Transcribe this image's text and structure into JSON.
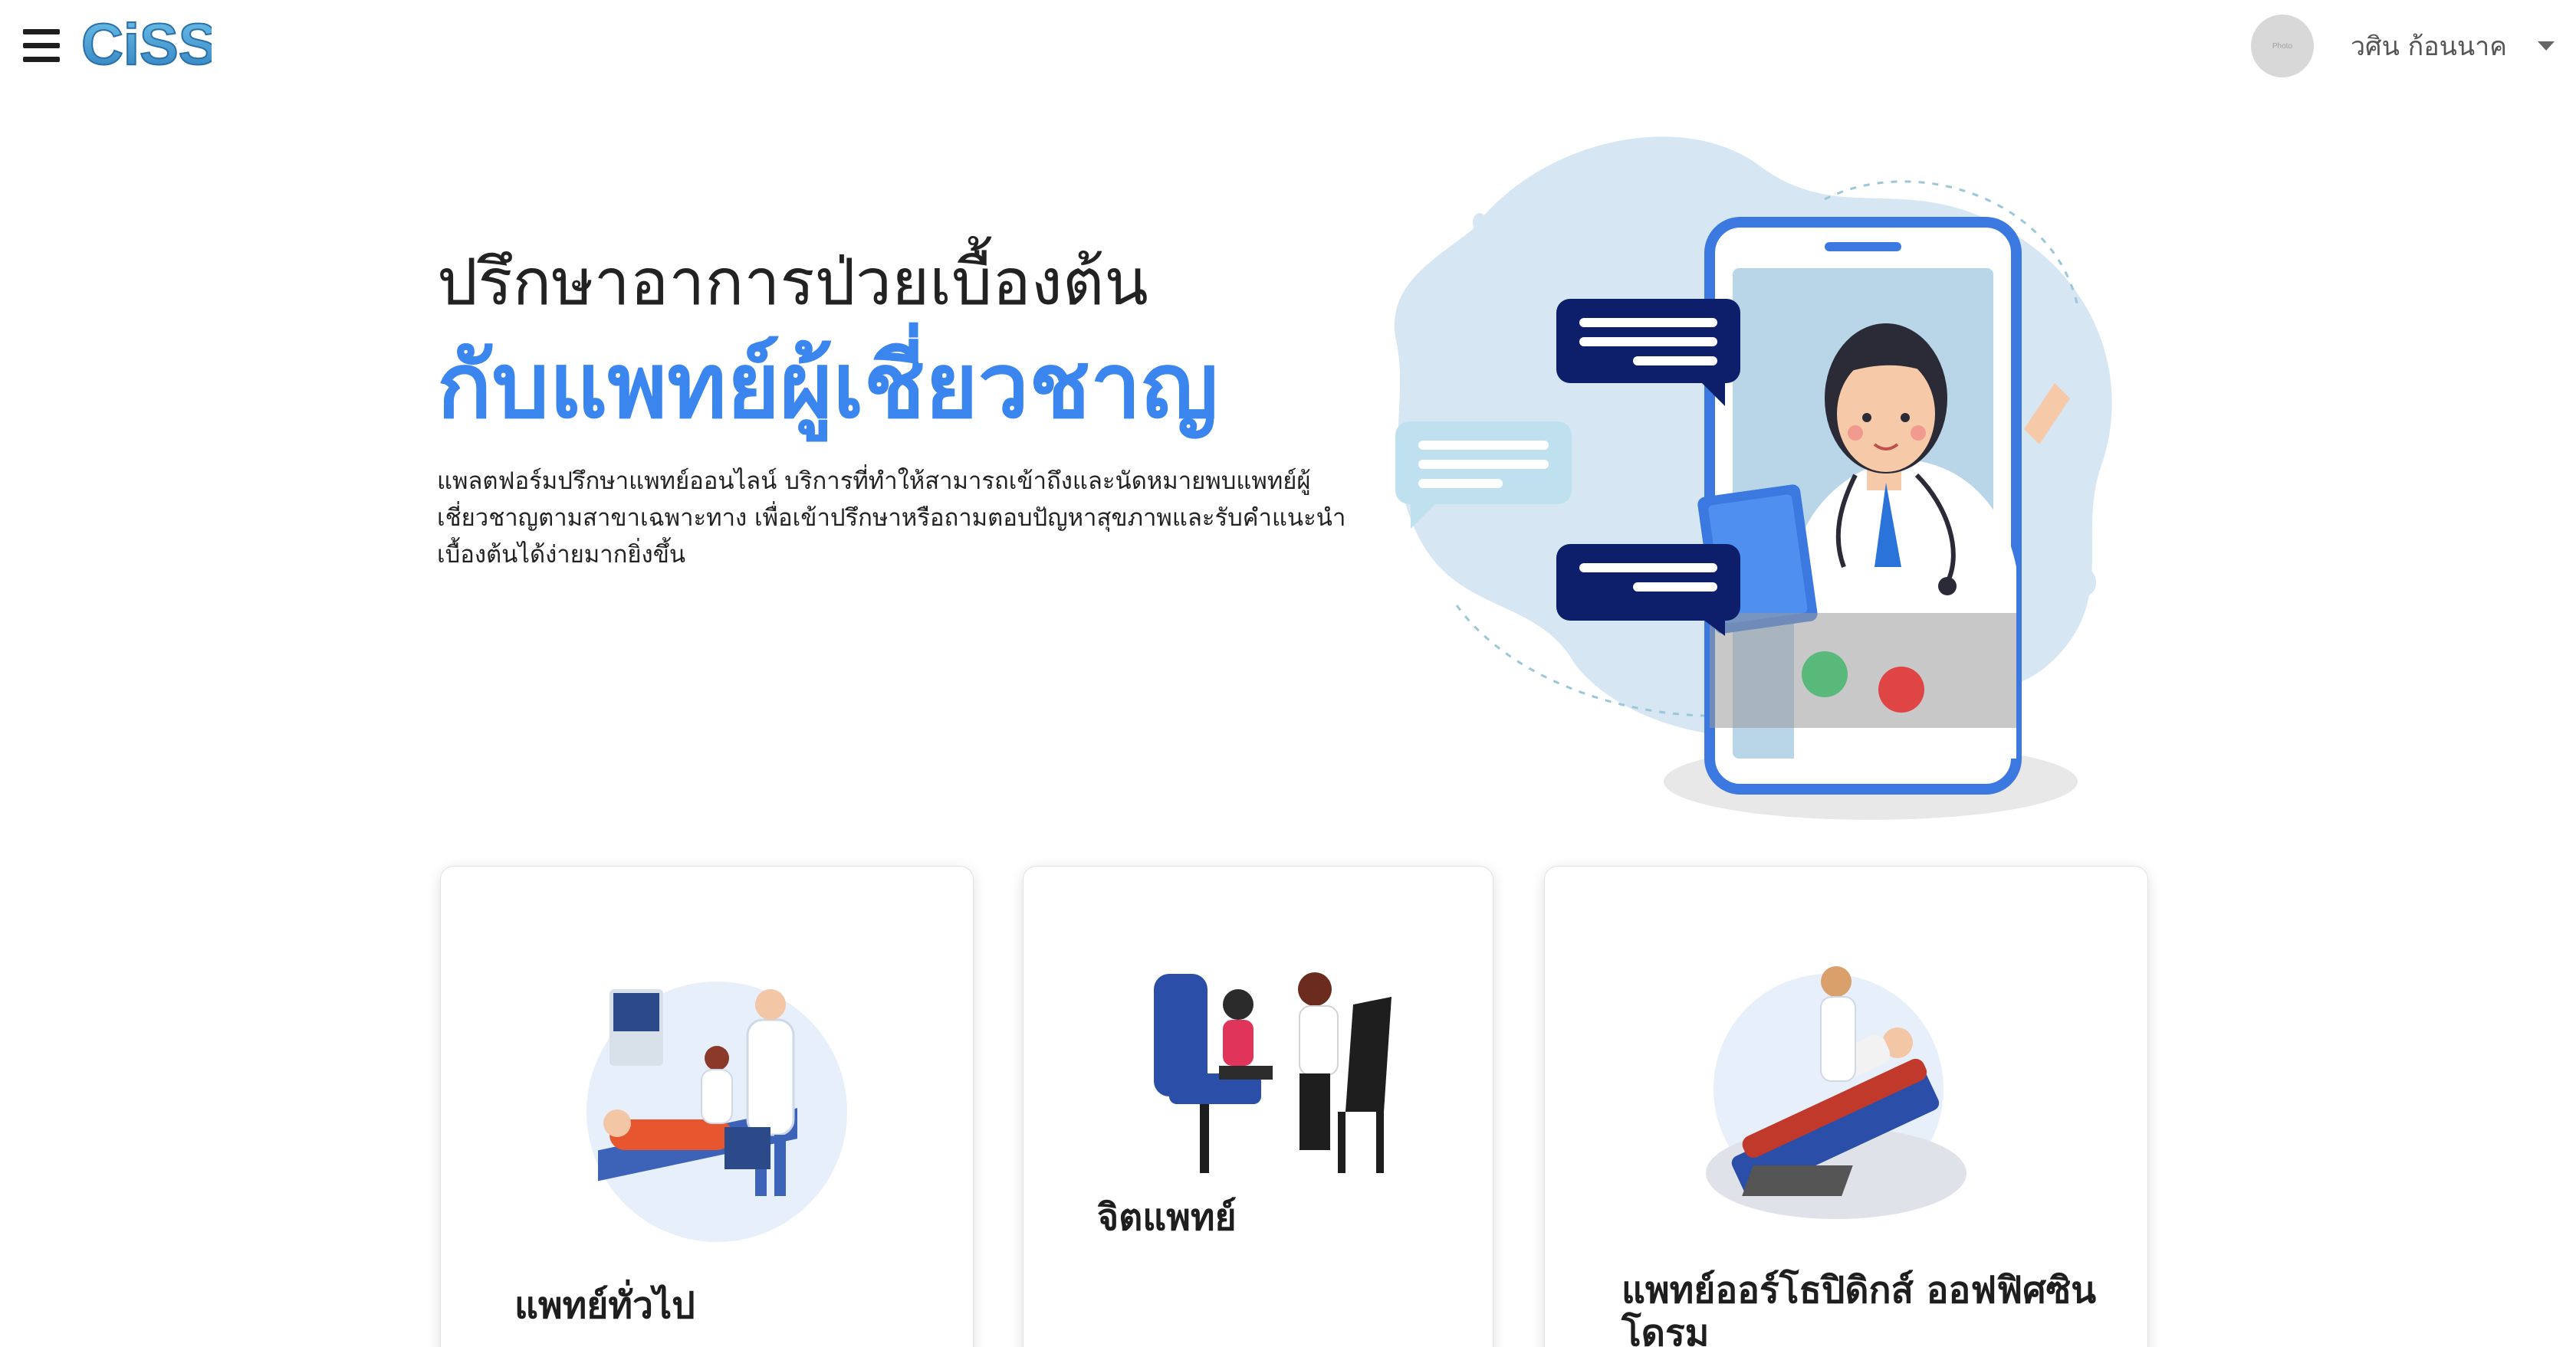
{
  "header": {
    "logo_text": "CiSS",
    "avatar_text": "Photo",
    "user_name": "วศิน ก้อนนาค"
  },
  "hero": {
    "title_line1": "ปรึกษาอาการป่วยเบื้องต้น",
    "title_line2": "กับแพทย์ผู้เชี่ยวชาญ",
    "description": "แพลตฟอร์มปรึกษาแพทย์ออนไลน์ บริการที่ทำให้สามารถเข้าถึงและนัดหมายพบแพทย์ผู้เชี่ยวชาญตามสาขาเฉพาะทาง เพื่อเข้าปรึกษาหรือถามตอบปัญหาสุขภาพและรับคำแนะนำเบื้องต้นได้ง่ายมากยิ่งขึ้น"
  },
  "specialties": [
    {
      "label": "แพทย์ทั่วไป"
    },
    {
      "label": "จิตแพทย์"
    },
    {
      "label": "แพทย์ออร์โธปิดิกส์ ออฟฟิศซินโดรม"
    }
  ],
  "colors": {
    "accent_blue": "#3b86ee",
    "illustration_light_blue": "#d6e6f3",
    "chat_navy": "#0d1f6b"
  }
}
